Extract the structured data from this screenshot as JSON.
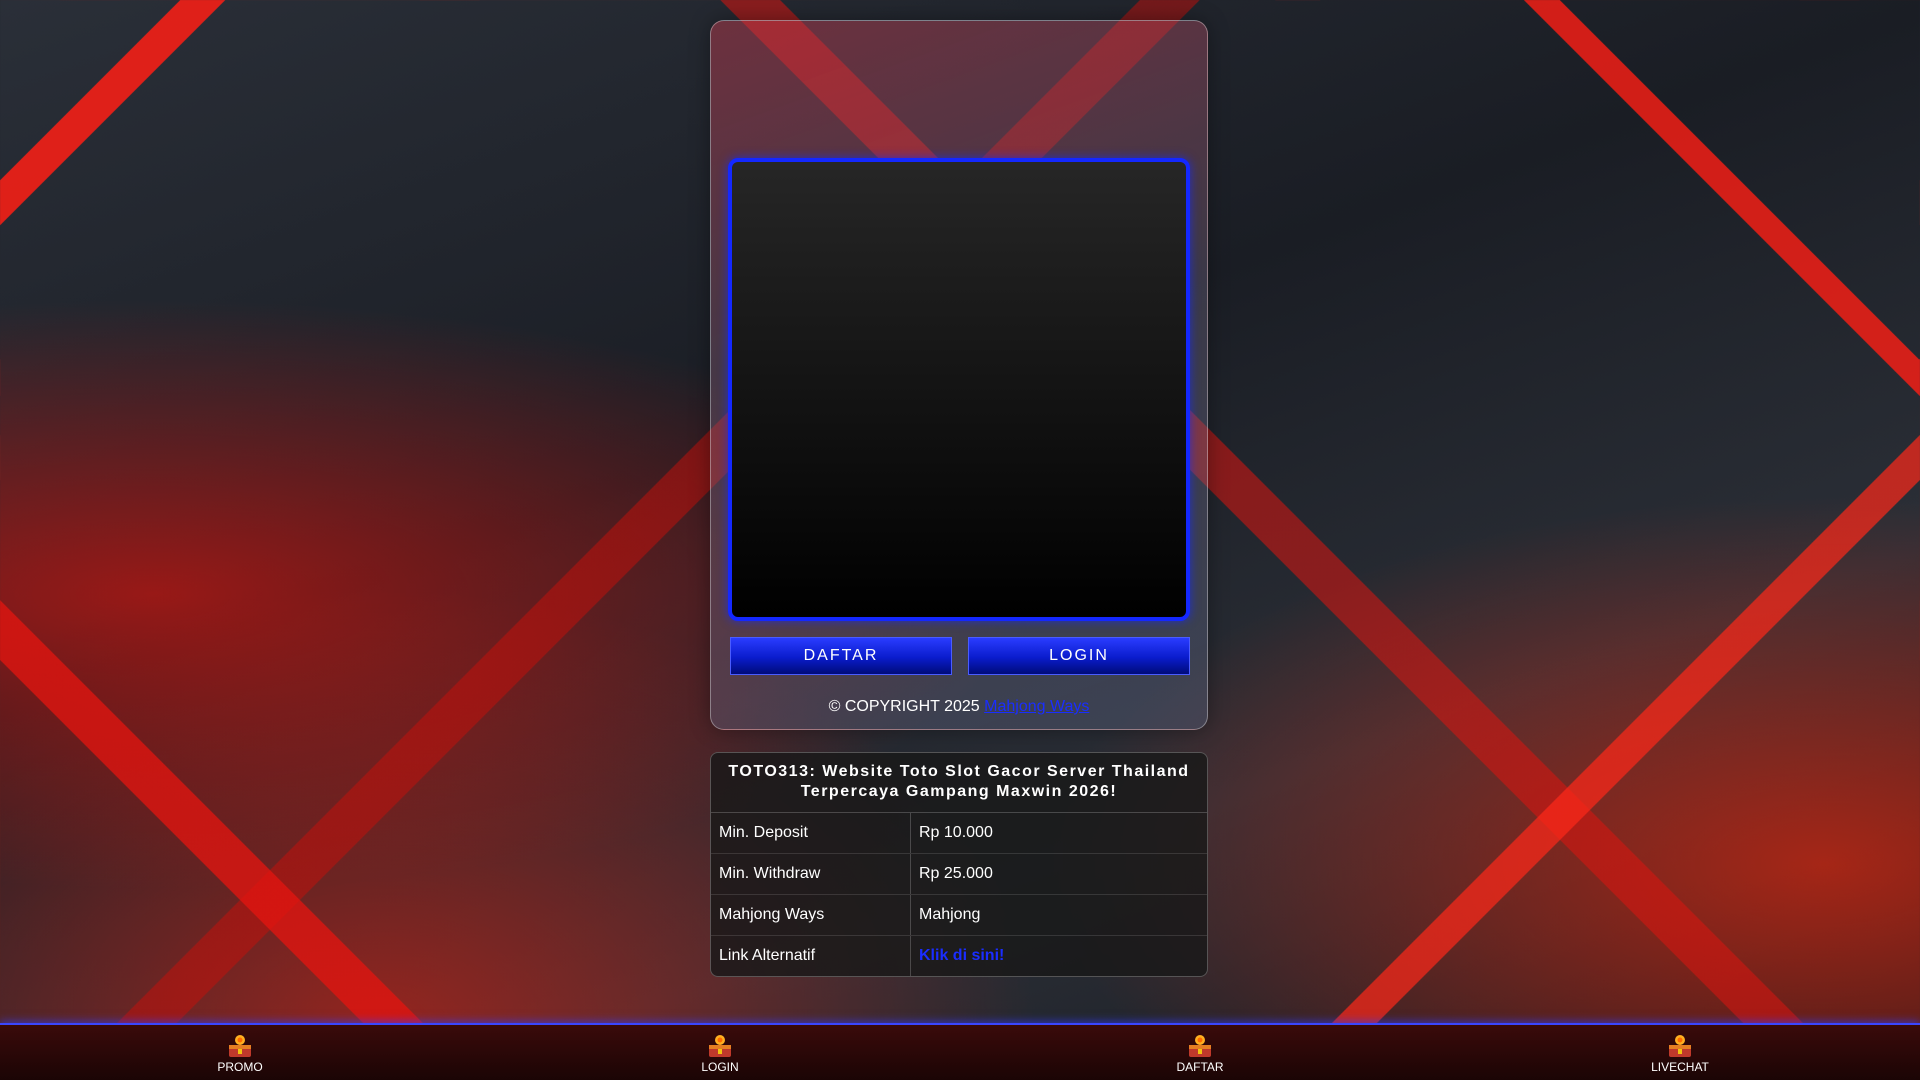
{
  "main_card": {
    "daftar_label": "DAFTAR",
    "login_label": "LOGIN",
    "copyright_text": "© COPYRIGHT 2025",
    "copyright_link": "Mahjong Ways"
  },
  "info": {
    "title": "TOTO313: Website Toto Slot Gacor Server Thailand Terpercaya Gampang Maxwin 2026!",
    "rows": [
      {
        "key": "Min. Deposit",
        "value": "Rp 10.000"
      },
      {
        "key": "Min. Withdraw",
        "value": "Rp 25.000"
      },
      {
        "key": "Mahjong Ways",
        "value": "Mahjong"
      },
      {
        "key": "Link Alternatif",
        "value": "Klik di sini!"
      }
    ],
    "link_color": "#1a2dff"
  },
  "bottom_nav": {
    "items": [
      {
        "label": "PROMO",
        "icon": "treasure-icon"
      },
      {
        "label": "LOGIN",
        "icon": "treasure-icon"
      },
      {
        "label": "DAFTAR",
        "icon": "treasure-icon"
      },
      {
        "label": "LIVECHAT",
        "icon": "treasure-icon"
      }
    ]
  },
  "colors": {
    "accent_blue": "#1428ff",
    "nav_border": "#3a46ff"
  }
}
